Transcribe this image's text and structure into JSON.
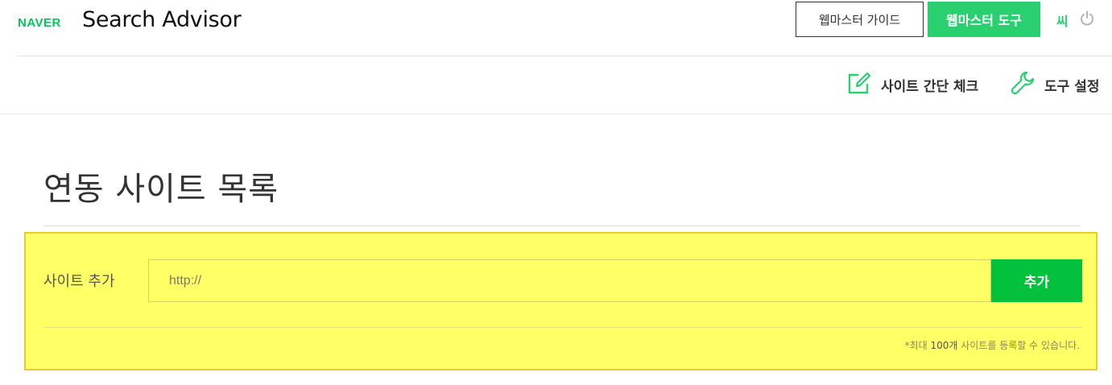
{
  "header": {
    "brand": "NAVER",
    "title": "Search Advisor",
    "guide_button": "웹마스터 가이드",
    "tools_button": "웹마스터 도구",
    "user_name": "씨",
    "power_icon": "power-icon"
  },
  "subnav": {
    "items": [
      {
        "label": "사이트 간단 체크",
        "icon": "edit-check-icon"
      },
      {
        "label": "도구 설정",
        "icon": "wrench-icon"
      }
    ]
  },
  "main": {
    "title": "연동 사이트 목록",
    "add_site": {
      "label": "사이트 추가",
      "placeholder": "http://",
      "button": "추가",
      "note_prefix": "*최대 ",
      "note_number": "100개",
      "note_suffix": " 사이트를 등록할 수 있습니다."
    }
  },
  "colors": {
    "brand_green": "#03c75a",
    "button_green": "#2acf70",
    "add_button_green": "#03c13d",
    "highlight_yellow": "#ffff66"
  }
}
